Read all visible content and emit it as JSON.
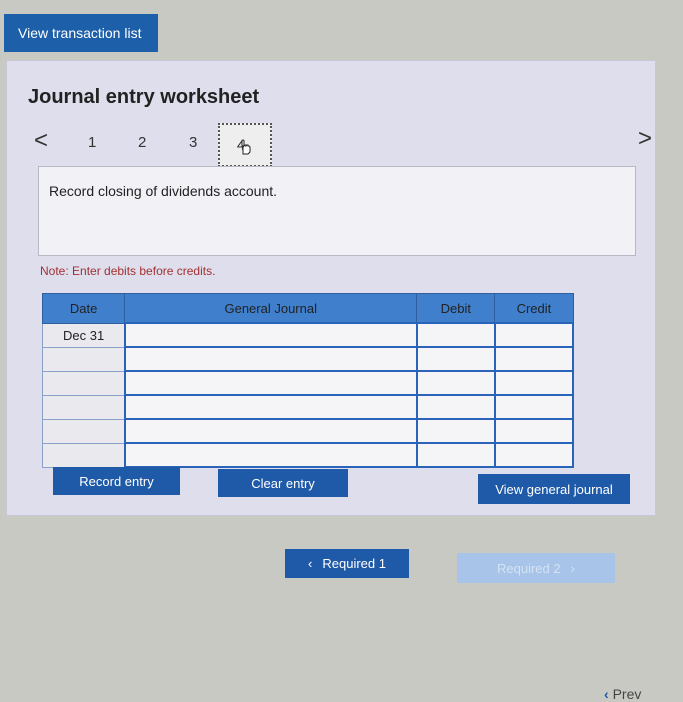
{
  "top": {
    "view_transaction_list": "View transaction list"
  },
  "worksheet": {
    "title": "Journal entry worksheet",
    "prev_arrow": "<",
    "next_arrow": ">",
    "steps": [
      "1",
      "2",
      "3",
      "4"
    ],
    "prompt": "Record closing of dividends account.",
    "note": "Note: Enter debits before credits."
  },
  "journal": {
    "headers": {
      "date": "Date",
      "general_journal": "General Journal",
      "debit": "Debit",
      "credit": "Credit"
    },
    "rows": [
      {
        "date": "Dec 31",
        "account": "",
        "debit": "",
        "credit": ""
      },
      {
        "date": "",
        "account": "",
        "debit": "",
        "credit": ""
      },
      {
        "date": "",
        "account": "",
        "debit": "",
        "credit": ""
      },
      {
        "date": "",
        "account": "",
        "debit": "",
        "credit": ""
      },
      {
        "date": "",
        "account": "",
        "debit": "",
        "credit": ""
      },
      {
        "date": "",
        "account": "",
        "debit": "",
        "credit": ""
      }
    ]
  },
  "buttons": {
    "record_entry": "Record entry",
    "clear_entry": "Clear entry",
    "view_general_journal": "View general journal"
  },
  "pager": {
    "required_1": "Required 1",
    "required_2": "Required 2",
    "prev": "Prev"
  },
  "colors": {
    "accent": "#1f5aa8",
    "header": "#3f7fcc",
    "note": "#a33030"
  }
}
